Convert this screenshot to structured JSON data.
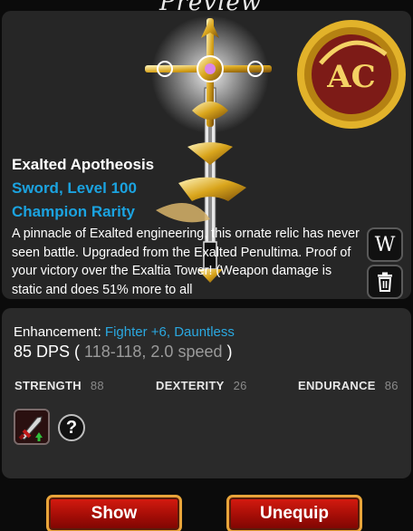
{
  "window": {
    "title": "Preview"
  },
  "item": {
    "name": "Exalted Apotheosis",
    "type_level": "Sword, Level 100",
    "rarity": "Champion Rarity",
    "description": "A pinnacle of Exalted engineering, this ornate relic has never seen battle. Upgraded from the Exalted Penultima. Proof of your victory over the Exaltia Tower! (Weapon damage is static and does 51% more to all",
    "art_icon": "ornate-golden-sword-icon",
    "badge_text": "AC",
    "badge_icon": "ac-gold-coin-badge"
  },
  "side_buttons": {
    "wiki_label": "W",
    "wiki_icon": "wiki-icon",
    "delete_icon": "trash-icon"
  },
  "stats": {
    "enhancement_label": "Enhancement:",
    "enhancement_value": "Fighter +6, Dauntless",
    "dps_main": "85 DPS (",
    "dps_range": " 118-118, 2.0 speed ",
    "dps_close": ")",
    "strength_label": "STRENGTH",
    "strength_value": "88",
    "dexterity_label": "DEXTERITY",
    "dexterity_value": "26",
    "endurance_label": "ENDURANCE",
    "endurance_value": "86"
  },
  "icons": {
    "skill_icon": "sword-upgrade-icon",
    "help_label": "?"
  },
  "actions": {
    "show_label": "Show",
    "unequip_label": "Unequip"
  },
  "colors": {
    "accent_blue": "#1ba3e0",
    "button_red": "#c0140a",
    "button_border": "#e9a53a",
    "panel_bg": "#262626"
  }
}
